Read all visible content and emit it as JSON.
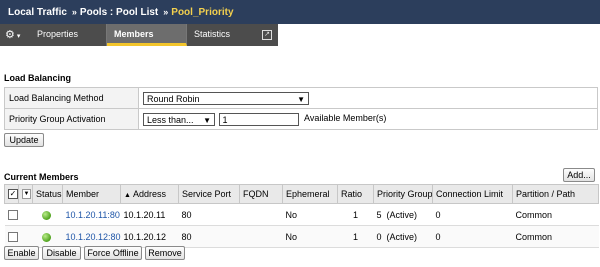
{
  "breadcrumb": {
    "items": [
      "Local Traffic",
      "Pools : Pool List"
    ],
    "current": "Pool_Priority",
    "separator": "»"
  },
  "tabs": {
    "gear_icon": "gear-icon",
    "items": [
      {
        "label": "Properties",
        "active": false
      },
      {
        "label": "Members",
        "active": true
      },
      {
        "label": "Statistics",
        "active": false
      }
    ],
    "popout_icon": "popout-icon"
  },
  "load_balancing": {
    "title": "Load Balancing",
    "method_label": "Load Balancing Method",
    "method_value": "Round Robin",
    "priority_label": "Priority Group Activation",
    "priority_select": "Less than...",
    "priority_value": "1",
    "priority_suffix": "Available Member(s)",
    "update_button": "Update"
  },
  "members": {
    "title": "Current Members",
    "add_button": "Add...",
    "columns": [
      "Status",
      "Member",
      "Address",
      "Service Port",
      "FQDN",
      "Ephemeral",
      "Ratio",
      "Priority Group",
      "Connection Limit",
      "Partition / Path"
    ],
    "rows": [
      {
        "status": "green",
        "member": "10.1.20.11:80",
        "address": "10.1.20.11",
        "port": "80",
        "fqdn": "",
        "ephemeral": "No",
        "ratio": "1",
        "priority_group": "5  (Active)",
        "conn_limit": "0",
        "partition": "Common"
      },
      {
        "status": "green",
        "member": "10.1.20.12:80",
        "address": "10.1.20.12",
        "port": "80",
        "fqdn": "",
        "ephemeral": "No",
        "ratio": "1",
        "priority_group": "0  (Active)",
        "conn_limit": "0",
        "partition": "Common"
      }
    ],
    "buttons": [
      "Enable",
      "Disable",
      "Force Offline",
      "Remove"
    ]
  },
  "colors": {
    "header_bg": "#2c3e5c",
    "current_crumb": "#f3d04e",
    "tab_active_underline": "#f3c52b",
    "link": "#1f56a8",
    "status_green": "#4fa21d"
  }
}
